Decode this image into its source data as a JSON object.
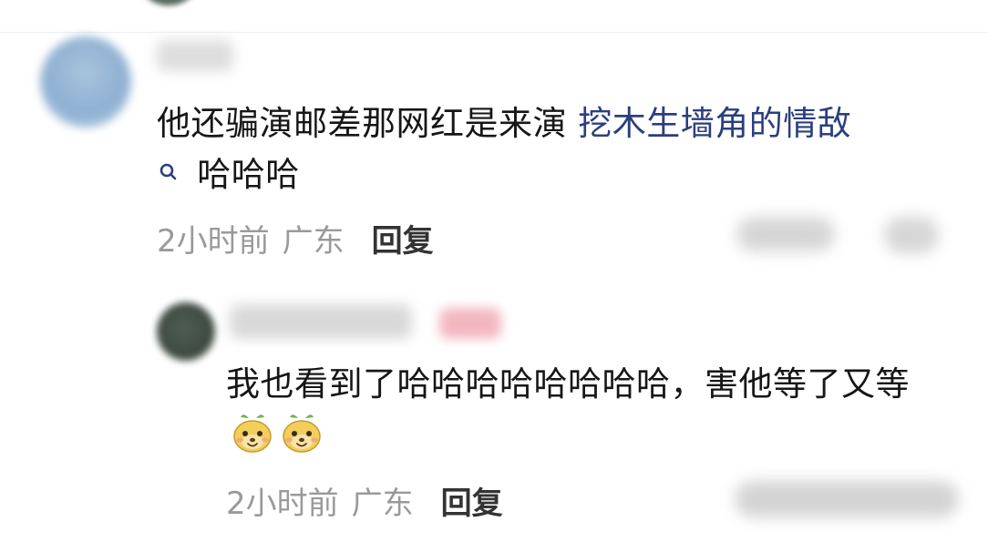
{
  "comment": {
    "text_main": "他还骗演邮差那网红是来演",
    "search_link": "挖木生墙角的情敌",
    "text_tail": "哈哈哈",
    "time": "2小时前",
    "location": "广东",
    "reply_label": "回复"
  },
  "sub_reply": {
    "text": "我也看到了哈哈哈哈哈哈哈哈，害他等了又等",
    "emojis": [
      "smiling-face-emoji",
      "smiling-face-emoji"
    ],
    "time": "2小时前",
    "location": "广东",
    "reply_label": "回复"
  },
  "colors": {
    "link": "#2b3f7e",
    "meta": "#9a9a9a",
    "reply": "#333333"
  },
  "icons": [
    "search-icon"
  ]
}
